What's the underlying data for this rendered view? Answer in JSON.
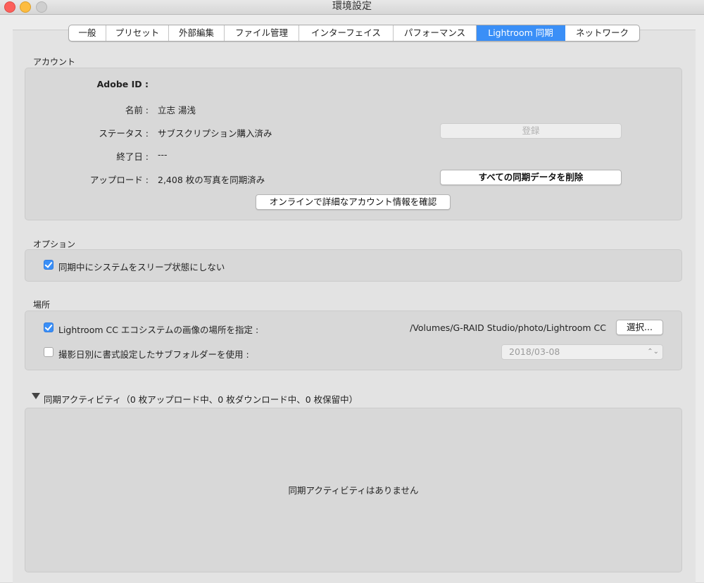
{
  "window": {
    "title": "環境設定"
  },
  "tabs": [
    {
      "label": "一般",
      "active": false
    },
    {
      "label": "プリセット",
      "active": false
    },
    {
      "label": "外部編集",
      "active": false
    },
    {
      "label": "ファイル管理",
      "active": false
    },
    {
      "label": "インターフェイス",
      "active": false
    },
    {
      "label": "パフォーマンス",
      "active": false
    },
    {
      "label": "Lightroom 同期",
      "active": true
    },
    {
      "label": "ネットワーク",
      "active": false
    }
  ],
  "account": {
    "section_title": "アカウント",
    "adobe_id_label": "Adobe ID :",
    "adobe_id_value": "",
    "name_label": "名前 :",
    "name_value": "立志 湯浅",
    "status_label": "ステータス :",
    "status_value": "サブスクリプション購入済み",
    "register_button": "登録",
    "end_date_label": "終了日 :",
    "end_date_value": "---",
    "upload_label": "アップロード :",
    "upload_value": "2,408 枚の写真を同期済み",
    "delete_button": "すべての同期データを削除",
    "online_button": "オンラインで詳細なアカウント情報を確認"
  },
  "options": {
    "section_title": "オプション",
    "no_sleep_label": "同期中にシステムをスリープ状態にしない",
    "no_sleep_checked": true
  },
  "location": {
    "section_title": "場所",
    "specify_label": "Lightroom CC エコシステムの画像の場所を指定 :",
    "specify_checked": true,
    "path": "/Volumes/G-RAID Studio/photo/Lightroom CC",
    "choose_button": "選択...",
    "subfolder_label": "撮影日別に書式設定したサブフォルダーを使用 :",
    "subfolder_checked": false,
    "date_format": "2018/03-08"
  },
  "activity": {
    "header": "同期アクティビティ（0 枚アップロード中、0 枚ダウンロード中、0 枚保留中）",
    "empty_message": "同期アクティビティはありません"
  },
  "colors": {
    "accent": "#3a8ff7",
    "close": "#fc605b",
    "minimize": "#fdbc40"
  }
}
